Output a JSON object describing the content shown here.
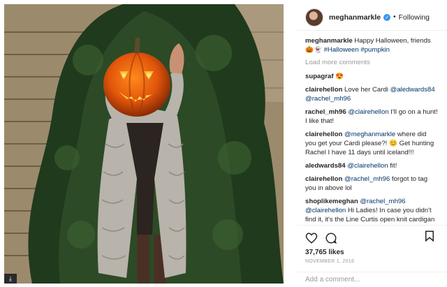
{
  "post": {
    "username": "meghanmarkle",
    "follow_label": "Following",
    "caption_user": "meghanmarkle",
    "caption_text": "Happy Halloween, friends",
    "caption_emoji": "🎃👻",
    "caption_tags": "#Halloween #pumpkin",
    "load_more": "Load more comments",
    "likes": "37,765 likes",
    "date": "NOVEMBER 1, 2016",
    "add_comment_placeholder": "Add a comment..."
  },
  "comments": [
    {
      "user": "supagraf",
      "pre": "",
      "mention": "",
      "text": "😍"
    },
    {
      "user": "clairehellon",
      "pre": "Love her Cardi ",
      "mention": "@aledwards84 @rachel_mh96",
      "text": ""
    },
    {
      "user": "rachel_mh96",
      "pre": "",
      "mention": "@clairehellon",
      "text": " I'll go on a hunt! I like that!"
    },
    {
      "user": "clairehellon",
      "pre": "",
      "mention": "@meghanmarkle",
      "text": " where did you get your Cardi please?! 😊 Get hunting Rachel I have 11 days until iceland!!!"
    },
    {
      "user": "aledwards84",
      "pre": "",
      "mention": "@clairehellon",
      "text": " fit!"
    },
    {
      "user": "clairehellon",
      "pre": "",
      "mention": "@rachel_mh96",
      "text": " forgot to tag you in above lol"
    },
    {
      "user": "shoplikemeghan",
      "pre": "",
      "mention": "@rachel_mh96 @clairehellon",
      "text": " Hi Ladies! In case you didn't find it, it's the Line Curtis open knit cardigan"
    }
  ],
  "icons": {
    "like": "heart-icon",
    "comment": "comment-icon",
    "save": "bookmark-icon",
    "verified": "verified-badge-icon"
  },
  "colors": {
    "mention": "#003569",
    "verified": "#3897f0",
    "muted": "#999999"
  },
  "overlay": {
    "download_glyph": "⤓"
  }
}
